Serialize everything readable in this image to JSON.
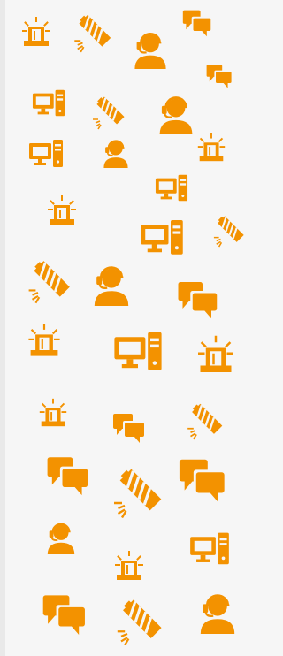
{
  "accent": "#F39200",
  "background": "#F6F6F6",
  "icons": [
    {
      "name": "siren-icon"
    },
    {
      "name": "firework-icon"
    },
    {
      "name": "headset-agent-icon"
    },
    {
      "name": "chat-bubbles-icon"
    },
    {
      "name": "chat-bubbles-icon"
    },
    {
      "name": "desktop-computer-icon"
    },
    {
      "name": "firework-icon"
    },
    {
      "name": "headset-agent-icon"
    },
    {
      "name": "desktop-computer-icon"
    },
    {
      "name": "headset-agent-icon"
    },
    {
      "name": "siren-icon"
    },
    {
      "name": "desktop-computer-icon"
    },
    {
      "name": "siren-icon"
    },
    {
      "name": "desktop-computer-icon"
    },
    {
      "name": "firework-icon"
    },
    {
      "name": "firework-icon"
    },
    {
      "name": "headset-agent-icon"
    },
    {
      "name": "chat-bubbles-icon"
    },
    {
      "name": "siren-icon"
    },
    {
      "name": "desktop-computer-icon"
    },
    {
      "name": "siren-icon"
    },
    {
      "name": "siren-icon"
    },
    {
      "name": "chat-bubbles-icon"
    },
    {
      "name": "firework-icon"
    },
    {
      "name": "chat-bubbles-icon"
    },
    {
      "name": "firework-icon"
    },
    {
      "name": "chat-bubbles-icon"
    },
    {
      "name": "headset-agent-icon"
    },
    {
      "name": "siren-icon"
    },
    {
      "name": "desktop-computer-icon"
    },
    {
      "name": "chat-bubbles-icon"
    },
    {
      "name": "firework-icon"
    },
    {
      "name": "headset-agent-icon"
    }
  ]
}
